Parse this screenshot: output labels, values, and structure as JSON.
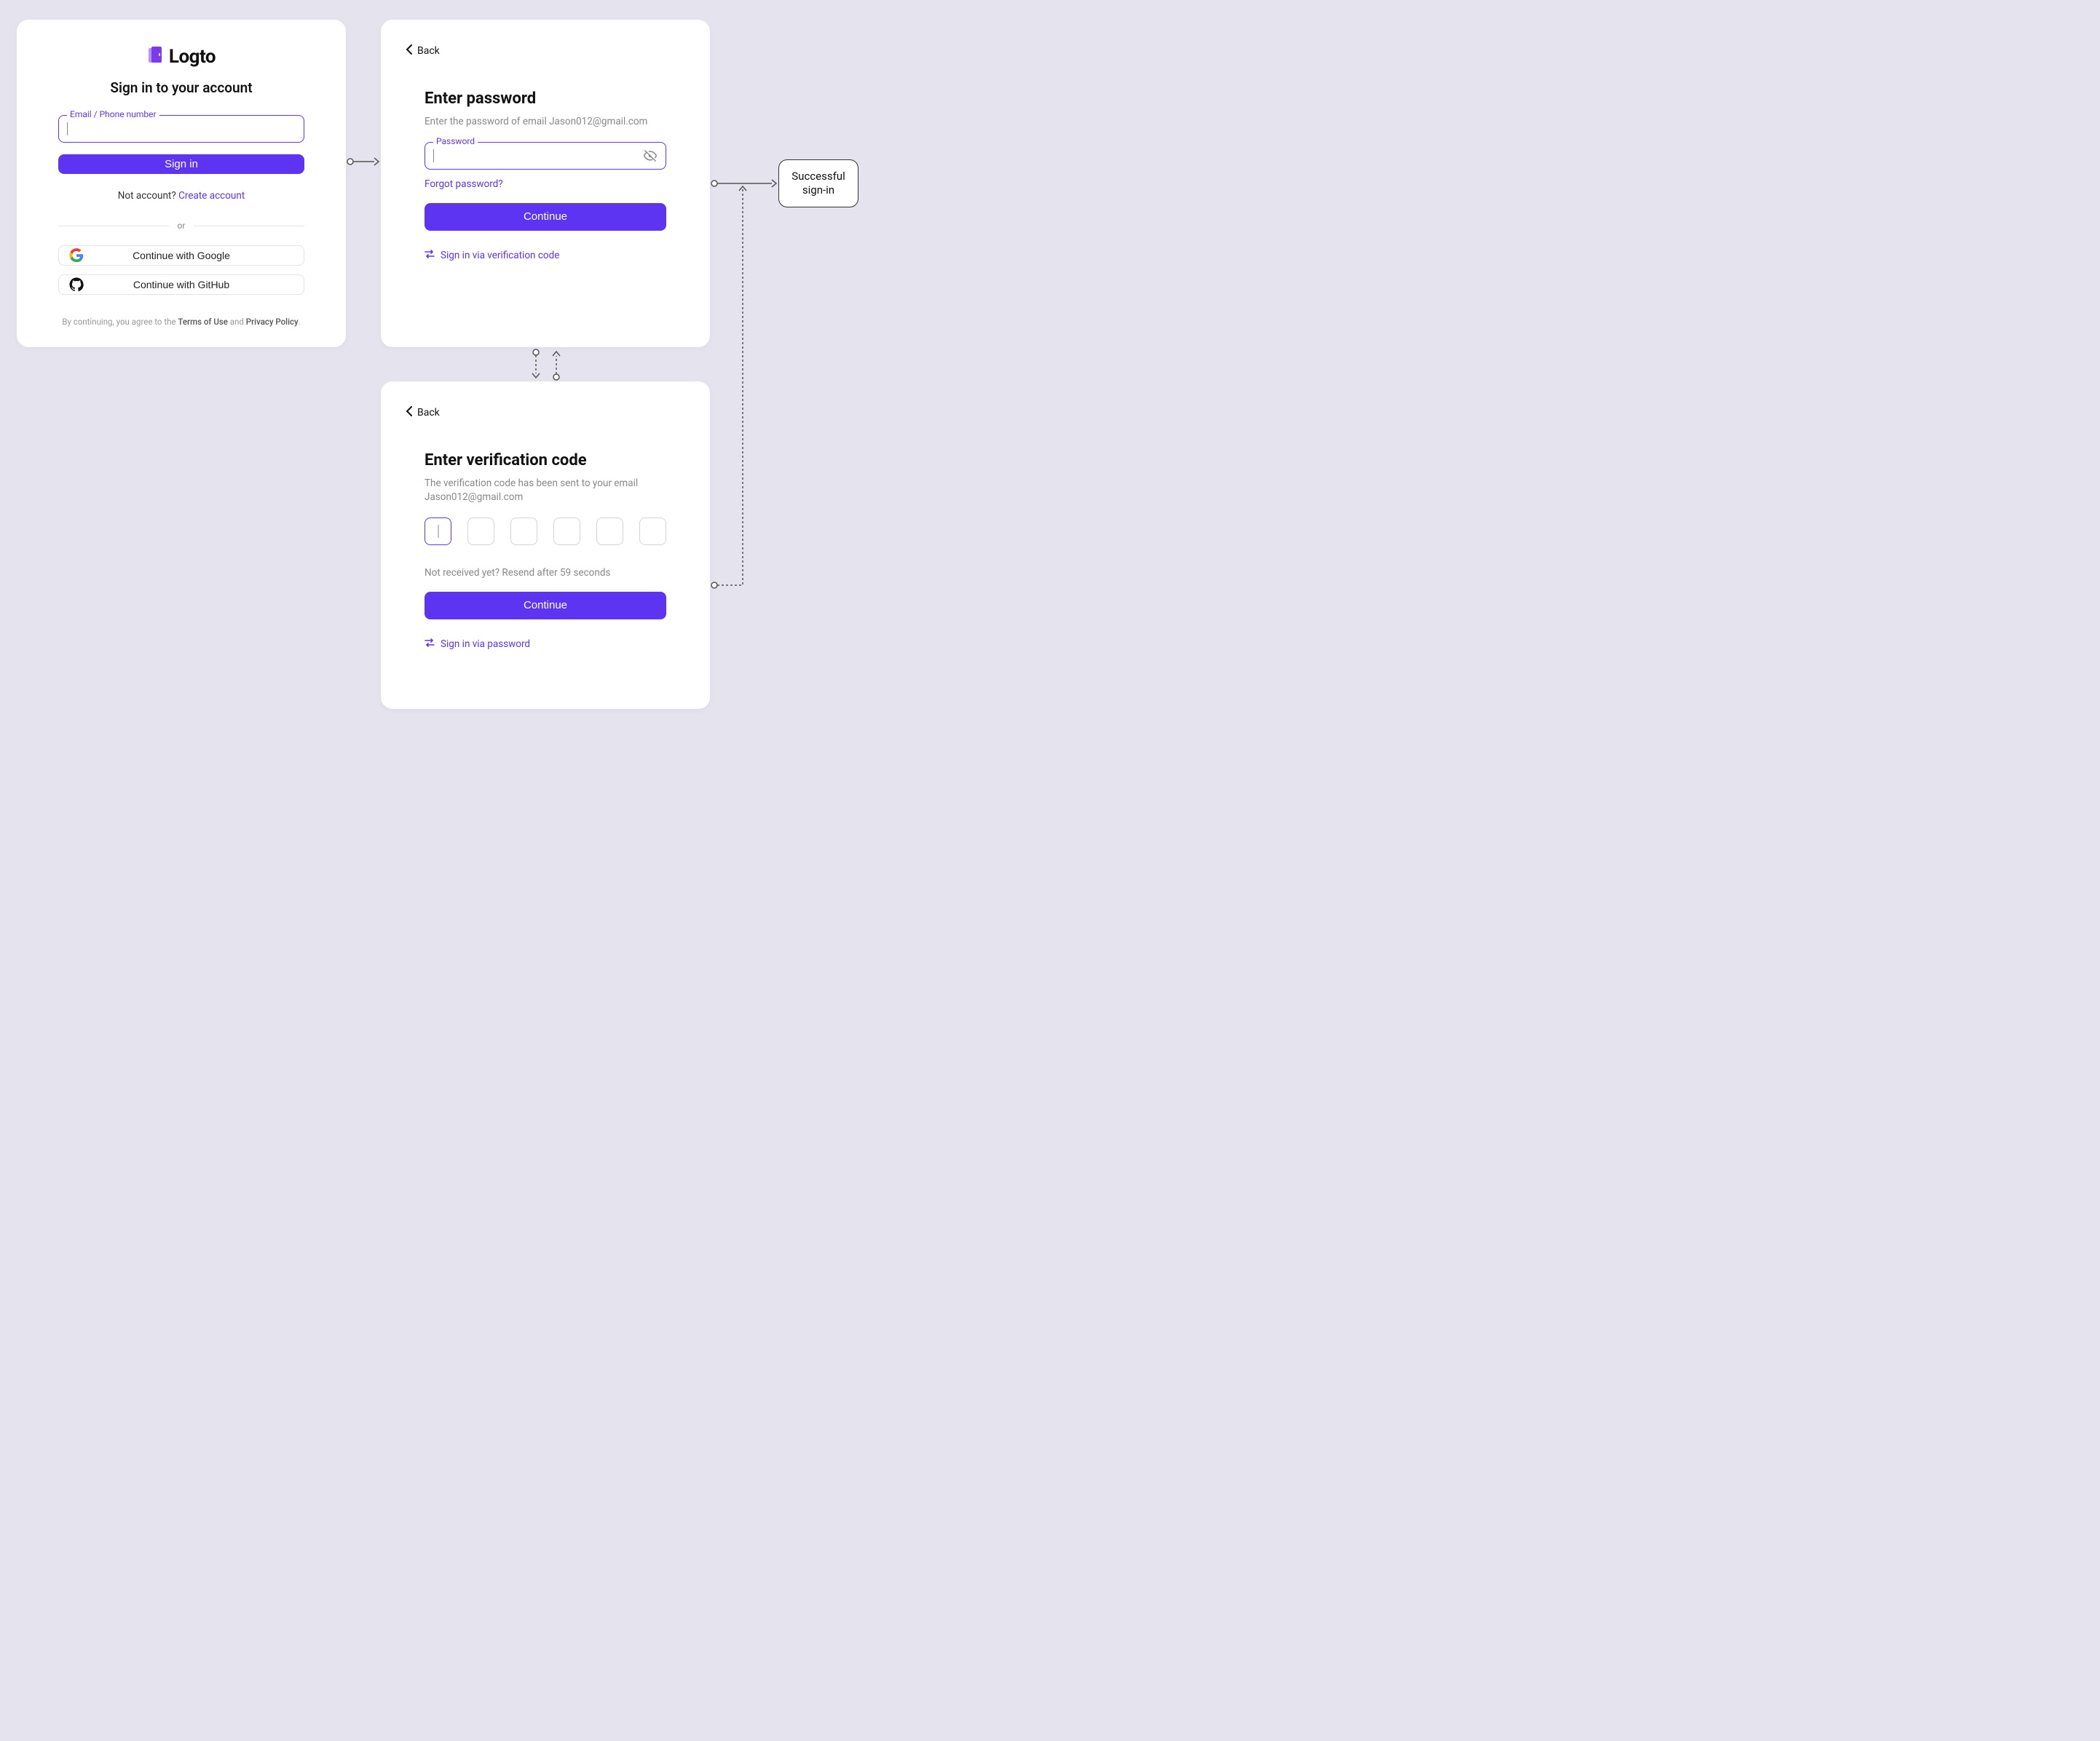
{
  "signin": {
    "logo_text": "Logto",
    "title": "Sign in to your account",
    "field_label": "Email / Phone number",
    "button": "Sign in",
    "no_account_prefix": "Not account? ",
    "create_account": "Create account",
    "divider": "or",
    "google": "Continue with Google",
    "github": "Continue with GitHub",
    "terms_prefix": "By continuing, you agree to the ",
    "terms_of_use": "Terms of Use",
    "terms_and": " and ",
    "privacy": "Privacy Policy",
    "terms_suffix": "."
  },
  "password": {
    "back": "Back",
    "title": "Enter password",
    "helper_prefix": "Enter the password of email ",
    "email": "Jason012@gmail.com",
    "field_label": "Password",
    "forgot": "Forgot password?",
    "button": "Continue",
    "alt": "Sign in via verification code"
  },
  "verify": {
    "back": "Back",
    "title": "Enter verification code",
    "helper_prefix": "The verification code has been sent to your email ",
    "email": "Jason012@gmail.com",
    "resend": "Not received yet? Resend after 59 seconds",
    "button": "Continue",
    "alt": "Sign in via password"
  },
  "success": "Successful sign-in"
}
